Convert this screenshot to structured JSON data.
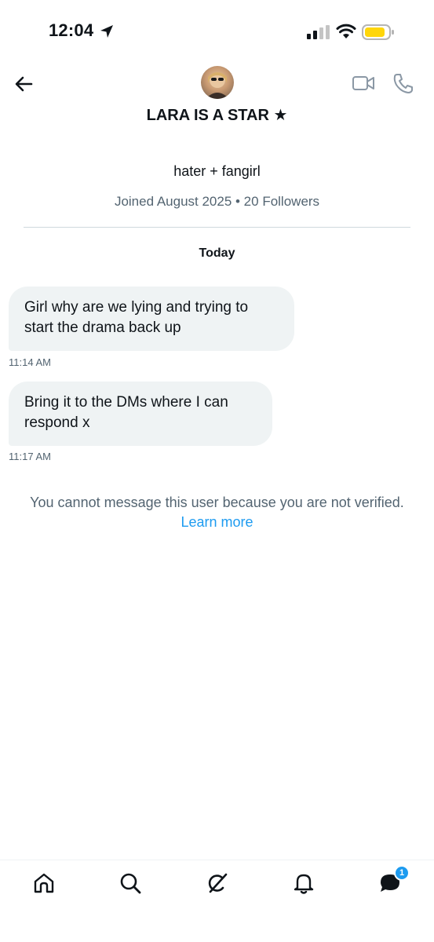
{
  "status_bar": {
    "time": "12:04",
    "battery_color": "#ffd60a",
    "icons": [
      "location-arrow-icon",
      "signal-icon",
      "wifi-icon",
      "battery-icon"
    ]
  },
  "header": {
    "display_name": "LARA IS A STAR ★",
    "icons": [
      "back-arrow-icon",
      "avatar",
      "video-camera-icon",
      "phone-icon"
    ]
  },
  "profile": {
    "bio": "hater + fangirl",
    "joined": "Joined August 2025 • 20 Followers"
  },
  "conversation": {
    "day_label": "Today",
    "messages": [
      {
        "text": "Girl why are we lying and trying to start the drama back up",
        "time": "11:14 AM"
      },
      {
        "text": "Bring it to the DMs where I can respond x",
        "time": "11:17 AM"
      }
    ],
    "notice": "You cannot message this user because you are not verified.",
    "learn_more": "Learn more"
  },
  "bottom_nav": {
    "items": [
      "home-icon",
      "search-icon",
      "grok-icon",
      "notifications-bell-icon",
      "messages-icon"
    ],
    "messages_badge": "1",
    "accent_color": "#1d9bf0"
  }
}
